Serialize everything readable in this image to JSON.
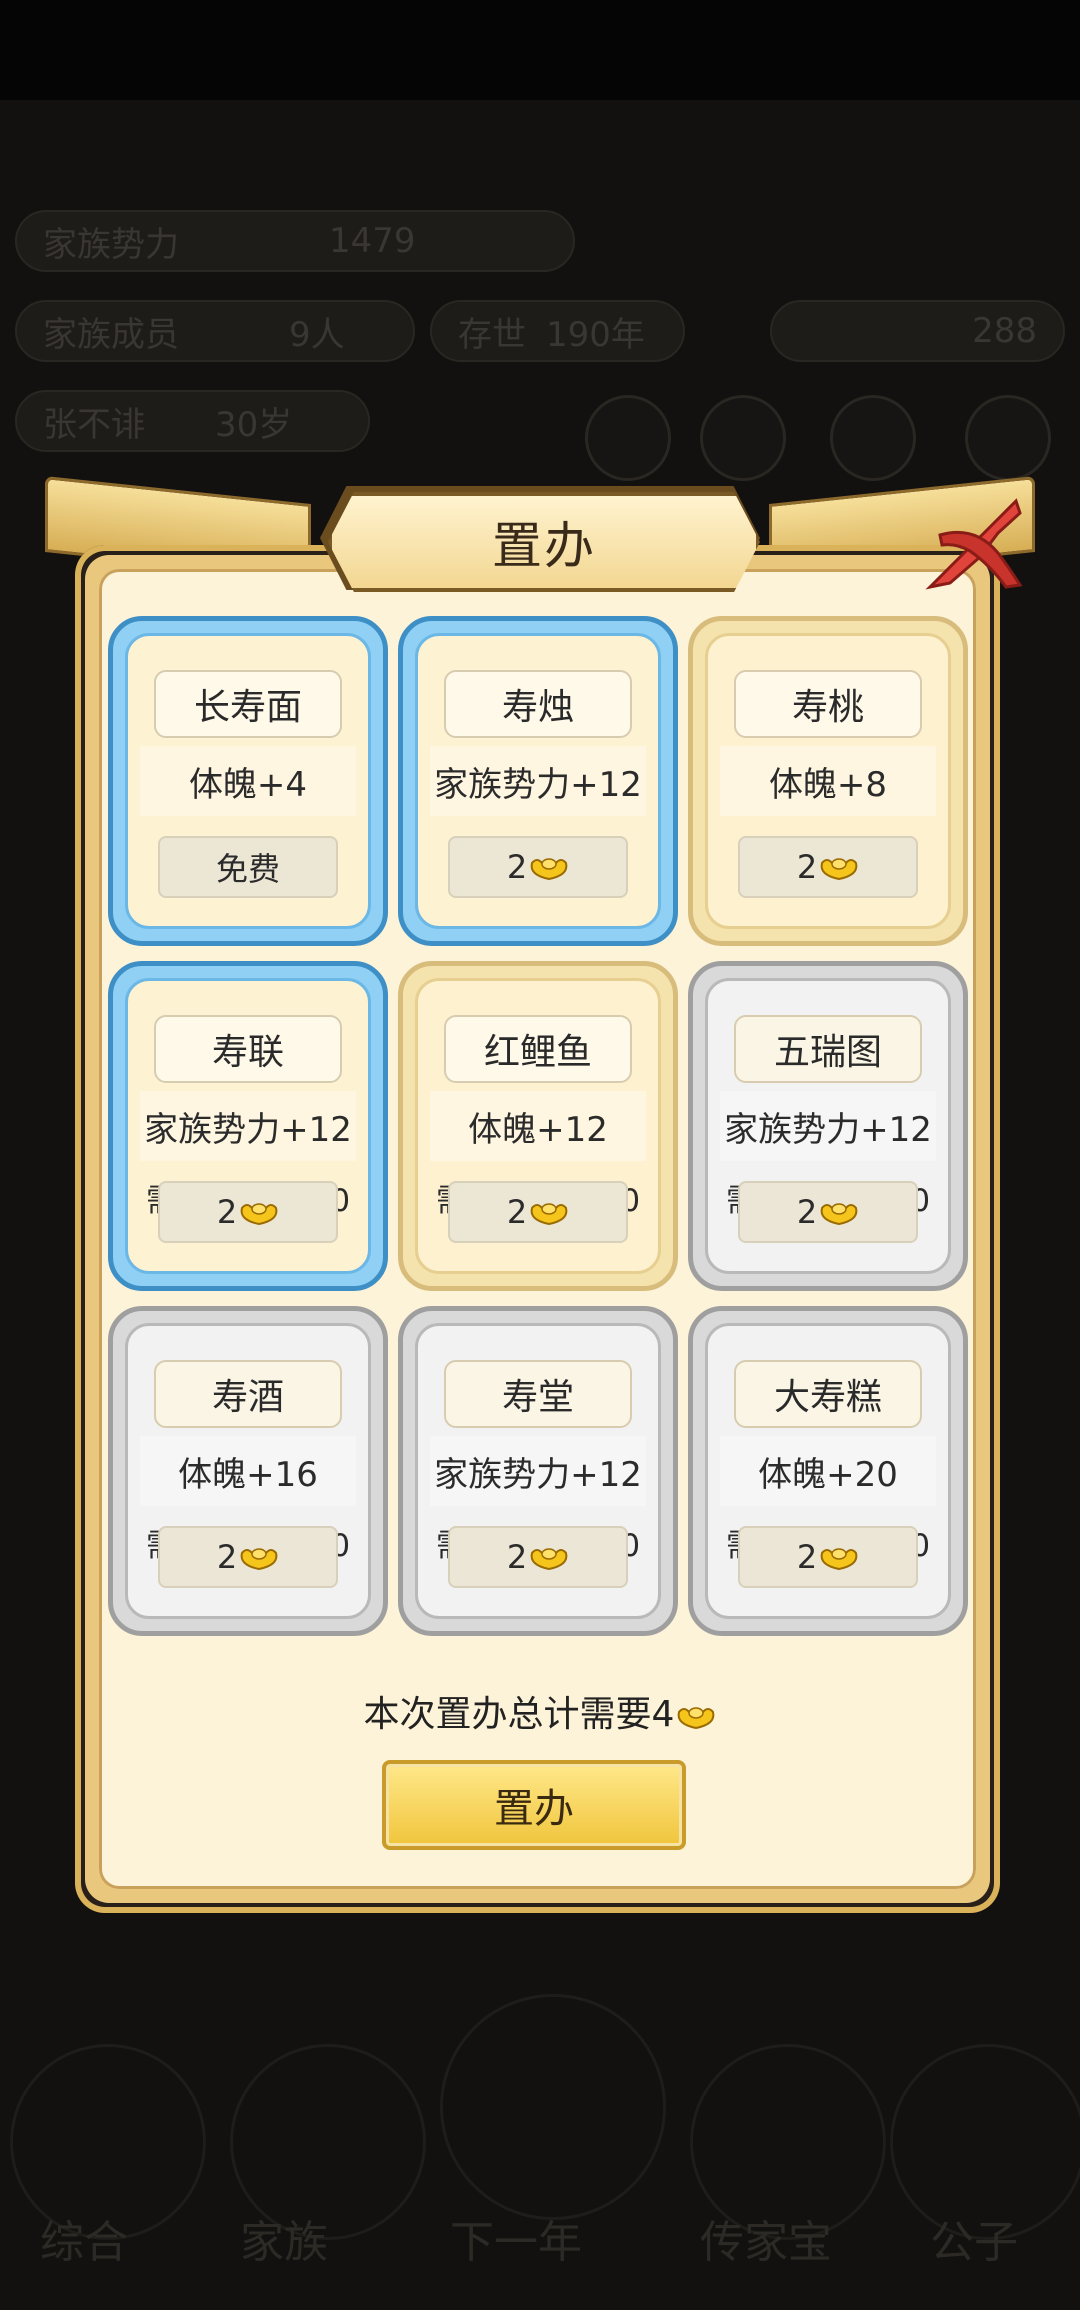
{
  "dialog": {
    "title": "置办",
    "close_icon": "close-x-icon",
    "items": [
      {
        "name": "长寿面",
        "effect": "体魄+4",
        "requirement": "",
        "price": "免费",
        "cost_icon": "",
        "tier": "blue"
      },
      {
        "name": "寿烛",
        "effect": "家族势力+12",
        "requirement": "",
        "price": "2",
        "cost_icon": "gold-ingot-icon",
        "tier": "blue"
      },
      {
        "name": "寿桃",
        "effect": "体魄+8",
        "requirement": "",
        "price": "2",
        "cost_icon": "gold-ingot-icon",
        "tier": "gold"
      },
      {
        "name": "寿联",
        "effect": "家族势力+12",
        "requirement": "需文才>=100",
        "price": "2",
        "cost_icon": "gold-ingot-icon",
        "tier": "blue"
      },
      {
        "name": "红鲤鱼",
        "effect": "体魄+12",
        "requirement": "需品行>=150",
        "price": "2",
        "cost_icon": "gold-ingot-icon",
        "tier": "gold"
      },
      {
        "name": "五瑞图",
        "effect": "家族势力+12",
        "requirement": "需天资>=200",
        "price": "2",
        "cost_icon": "gold-ingot-icon",
        "tier": "gray"
      },
      {
        "name": "寿酒",
        "effect": "体魄+16",
        "requirement": "需武艺>=250",
        "price": "2",
        "cost_icon": "gold-ingot-icon",
        "tier": "gray"
      },
      {
        "name": "寿堂",
        "effect": "家族势力+12",
        "requirement": "需谋略>=300",
        "price": "2",
        "cost_icon": "gold-ingot-icon",
        "tier": "gray"
      },
      {
        "name": "大寿糕",
        "effect": "体魄+20",
        "requirement": "需体魄>=350",
        "price": "2",
        "cost_icon": "gold-ingot-icon",
        "tier": "gray"
      }
    ],
    "total_text": "本次置办总计需要4",
    "confirm_label": "置办"
  },
  "background": {
    "pills": [
      "家族势力",
      "1479",
      "家族成员",
      "9人",
      "存世",
      "190年",
      "288",
      "张不诽",
      "30岁"
    ],
    "nav": [
      "综合",
      "家族",
      "下一年",
      "传家宝",
      "公子"
    ]
  },
  "colors": {
    "accent": "#f0c53c",
    "blue_tier": "#8fd0f4",
    "gold_tier": "#f5e3ae",
    "gray_tier": "#d9d9d9"
  }
}
